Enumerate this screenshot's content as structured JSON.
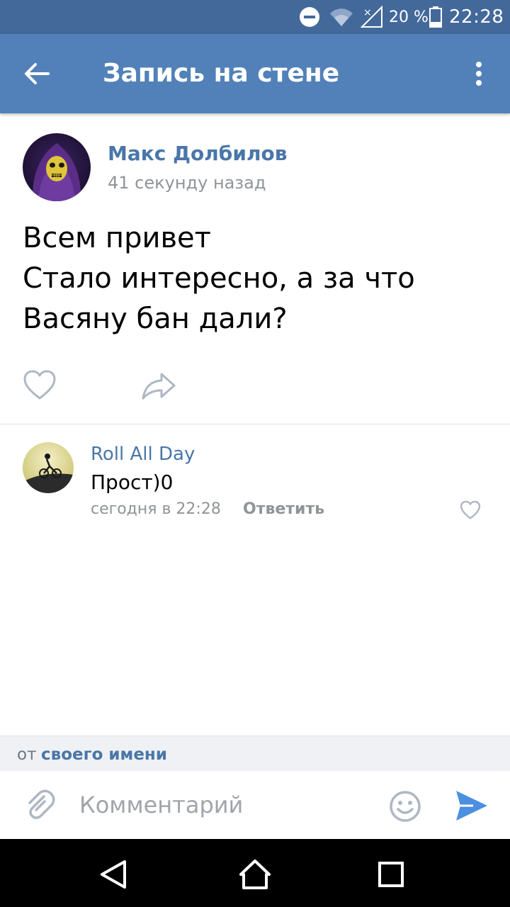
{
  "status_bar": {
    "battery_percent": "20 %",
    "time": "22:28",
    "icons": [
      "do-not-disturb-icon",
      "wifi-icon",
      "no-signal-icon",
      "battery-icon"
    ]
  },
  "app_bar": {
    "title": "Запись на стене",
    "background_color": "#5181b8",
    "icons": [
      "arrow-back-icon",
      "more-vertical-icon"
    ]
  },
  "post": {
    "author": "Макс Долбилов",
    "time": "41 секунду назад",
    "text_lines": [
      "Всем привет",
      "Стало интересно, а за что",
      "Васяну бан дали?"
    ],
    "icons": [
      "heart-outline-icon",
      "share-arrow-icon"
    ]
  },
  "comment": {
    "author": "Roll All Day",
    "text": "Прост)0",
    "time": "сегодня в 22:28",
    "reply_label": "Ответить",
    "icons": [
      "heart-outline-icon"
    ]
  },
  "composer": {
    "sender_prefix": "от",
    "sender_name": "своего имени",
    "placeholder": "Комментарий",
    "value": "",
    "icons": [
      "paperclip-icon",
      "smiley-icon",
      "send-icon"
    ]
  },
  "nav_bar": {
    "icons": [
      "nav-back-icon",
      "nav-home-icon",
      "nav-recents-icon"
    ]
  },
  "colors": {
    "status_bar": "#43699b",
    "accent": "#4a76a8",
    "send": "#4a8fe0",
    "secondary_text": "#909499"
  }
}
